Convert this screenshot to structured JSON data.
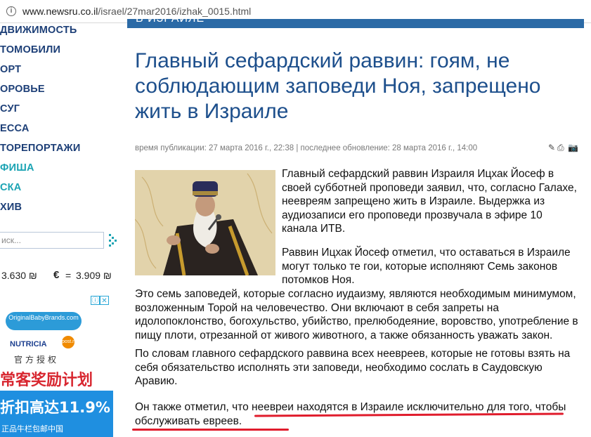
{
  "browser": {
    "url_host": "www.newsru.co.il",
    "url_path": "/israel/27mar2016/izhak_0015.html",
    "info_icon": "info-icon"
  },
  "sidebar": {
    "items": [
      {
        "label": "ДВИЖИМОСТЬ",
        "style": "dark"
      },
      {
        "label": "ТОМОБИЛИ",
        "style": "dark"
      },
      {
        "label": "ОРТ",
        "style": "dark"
      },
      {
        "label": "ОРОВЬЕ",
        "style": "dark"
      },
      {
        "label": "СУГ",
        "style": "dark"
      },
      {
        "label": "ЕССА",
        "style": "dark"
      },
      {
        "label": "ТОРЕПОРТАЖИ",
        "style": "dark"
      },
      {
        "label": "ФИША",
        "style": "teal"
      },
      {
        "label": "СКА",
        "style": "teal"
      },
      {
        "label": "ХИВ",
        "style": "dark"
      }
    ],
    "search_placeholder": "иск...",
    "rates": {
      "usd_value": "3.630 ₪",
      "euro_symbol": "€",
      "equals": "=",
      "eur_value": "3.909 ₪"
    }
  },
  "ad": {
    "brand": "OriginalBabyBrands.com",
    "maker": "NUTRICIA",
    "official": "官方授权",
    "promo": "常客奖励计划",
    "discount": "折扣高达11.9%",
    "guarantee": "正品牛栏包邮中国",
    "adchoice_info": "ⓘ",
    "adchoice_close": "✕",
    "badge_text": "post.nl"
  },
  "article": {
    "section": "В ИЗРАИЛЕ",
    "headline": "Главный сефардский раввин: гоям, не соблюдающим заповеди Ноя, запрещено жить в Израиле",
    "meta": "время публикации: 27 марта 2016 г., 22:38 | последнее обновление: 28 марта 2016 г., 14:00",
    "p1": "Главный сефардский раввин Израиля Ицхак Йосеф в своей субботней проповеди заявил, что, согласно Галахе, неевреям запрещено жить в Израиле. Выдержка из аудиозаписи его проповеди прозвучала в эфире 10 канала ИТВ.",
    "p2": "Раввин Ицхак Йосеф отметил, что оставаться в Израиле могут только те гои, которые исполняют Семь законов потомков Ноя.",
    "p2_cont": "Это семь заповедей, которые согласно иудаизму, являются необходимым минимумом, возложенным Торой на человечество. Они включают в себя запреты на идолопоклонство, богохульство, убийство, прелюбодеяние, воровство, употребление в пищу плоти, отрезанной от живого животного, а также обязанность уважать закон.",
    "p3": "По словам главного сефардского раввина всех неевреев, которые не готовы взять на себя обязательство исполнять эти заповеди, необходимо сослать в Саудовскую Аравию.",
    "p4": "Он также отметил, что неевреи находятся в Израиле исключительно для того, чтобы обслуживать евреев."
  },
  "colors": {
    "nav_dark": "#1d3f77",
    "nav_teal": "#1aa3b3",
    "headline": "#1d4f8c",
    "highlight": "#e01c2c"
  }
}
